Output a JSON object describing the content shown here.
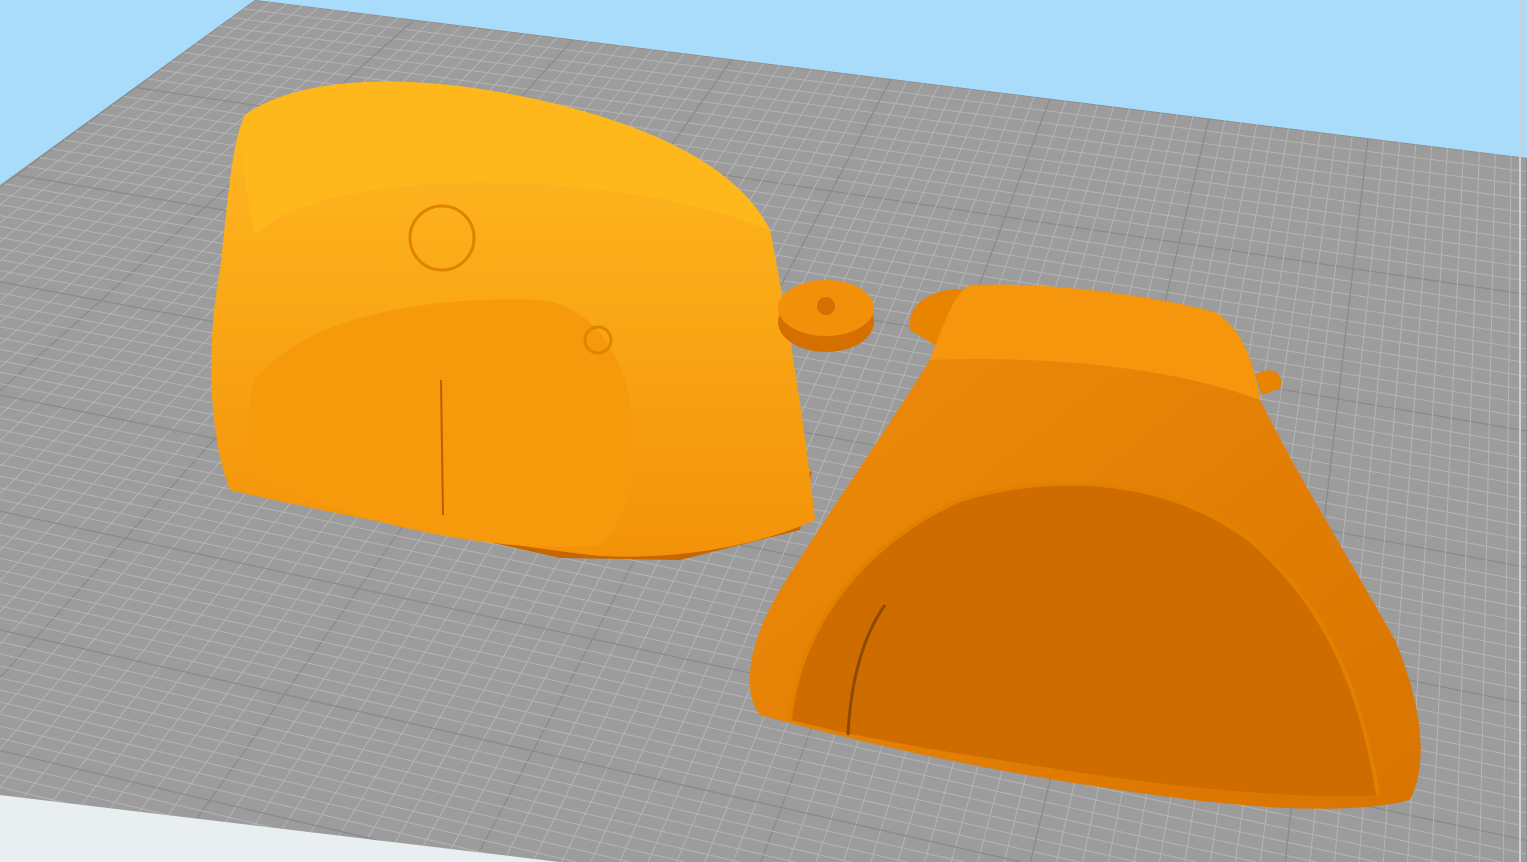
{
  "colors": {
    "sky": "#a9dcfb",
    "plate": "#9c9c9c",
    "grid": "#b4b4b4",
    "grid_major": "#8a8a8a",
    "floor": "#e9eef1",
    "object_light": "#ffb21a",
    "object_mid": "#f59a0c",
    "object_dark": "#d97200",
    "object_shadow": "#c56600"
  }
}
